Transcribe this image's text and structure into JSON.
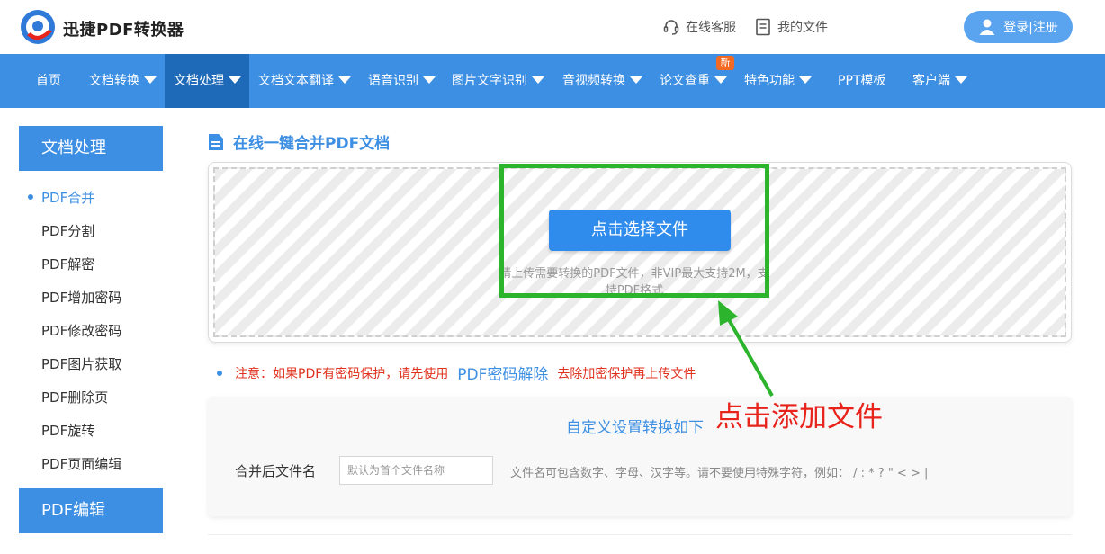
{
  "header": {
    "brand": "迅捷PDF转换器",
    "service": "在线客服",
    "my_files": "我的文件",
    "login": "登录|注册"
  },
  "nav": {
    "items": [
      {
        "label": "首页"
      },
      {
        "label": "文档转换"
      },
      {
        "label": "文档处理"
      },
      {
        "label": "文档文本翻译"
      },
      {
        "label": "语音识别"
      },
      {
        "label": "图片文字识别"
      },
      {
        "label": "音视频转换"
      },
      {
        "label": "论文查重"
      },
      {
        "label": "特色功能"
      },
      {
        "label": "PPT模板"
      },
      {
        "label": "客户端"
      }
    ],
    "new_badge": "新"
  },
  "sidebar": {
    "section1": "文档处理",
    "items": [
      {
        "label": "PDF合并"
      },
      {
        "label": "PDF分割"
      },
      {
        "label": "PDF解密"
      },
      {
        "label": "PDF增加密码"
      },
      {
        "label": "PDF修改密码"
      },
      {
        "label": "PDF图片获取"
      },
      {
        "label": "PDF删除页"
      },
      {
        "label": "PDF旋转"
      },
      {
        "label": "PDF页面编辑"
      }
    ],
    "section2": "PDF编辑"
  },
  "main": {
    "title": "在线一键合并PDF文档",
    "pick_button": "点击选择文件",
    "upload_hint": "请上传需要转换的PDF文件，非VIP最大支持2M，支持PDF格式",
    "note_prefix": "注意：如果PDF有密码保护，请先使用",
    "note_link": "PDF密码解除",
    "note_suffix": "去除加密保护再上传文件",
    "callout": "点击添加文件",
    "settings_title": "自定义设置转换如下",
    "filename_label": "合并后文件名",
    "filename_placeholder": "默认为首个文件名称",
    "filename_help": "文件名可包含数字、字母、汉字等。请不要使用特殊字符，例如：  / : * ? \" < > |"
  },
  "colors": {
    "primary": "#3d8fe3",
    "nav_active": "#1e6ab9",
    "highlight_box": "#2cb52c",
    "callout": "#e8231b",
    "warning": "#e0301e"
  }
}
